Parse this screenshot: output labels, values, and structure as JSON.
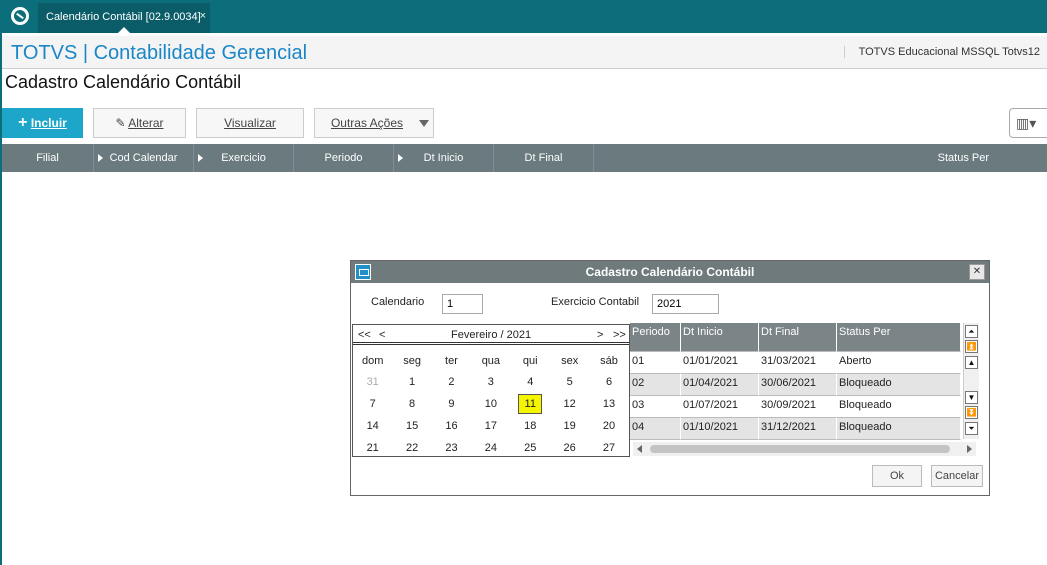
{
  "tab": {
    "title": "Calendário Contábil [02.9.0034]",
    "close": "×"
  },
  "header": {
    "app_title": "TOTVS | Contabilidade Gerencial",
    "env_info": "TOTVS Educacional MSSQL Totvs12"
  },
  "page": {
    "title": "Cadastro Calendário Contábil"
  },
  "toolbar": {
    "incluir": "Incluir",
    "alterar": "Alterar",
    "visualizar": "Visualizar",
    "outras_acoes": "Outras Ações"
  },
  "grid": {
    "columns": [
      "Filial",
      "Cod Calendar",
      "Exercicio",
      "Periodo",
      "Dt Inicio",
      "Dt Final",
      "Status Per"
    ]
  },
  "dialog": {
    "title": "Cadastro Calendário Contábil",
    "calendario_label": "Calendario",
    "calendario_value": "1",
    "exercicio_label": "Exercicio Contabil",
    "exercicio_value": "2021",
    "ok": "Ok",
    "cancel": "Cancelar"
  },
  "calendar": {
    "nav_prev_year": "<<",
    "nav_prev": "<",
    "month_label": "Fevereiro / 2021",
    "nav_next": ">",
    "nav_next_year": ">>",
    "weekdays": [
      "dom",
      "seg",
      "ter",
      "qua",
      "qui",
      "sex",
      "sáb"
    ],
    "weeks": [
      [
        "31",
        "1",
        "2",
        "3",
        "4",
        "5",
        "6"
      ],
      [
        "7",
        "8",
        "9",
        "10",
        "11",
        "12",
        "13"
      ],
      [
        "14",
        "15",
        "16",
        "17",
        "18",
        "19",
        "20"
      ],
      [
        "21",
        "22",
        "23",
        "24",
        "25",
        "26",
        "27"
      ]
    ],
    "selected_day": "11",
    "highlight_color": "#f5f500"
  },
  "periods": {
    "columns": [
      "Periodo",
      "Dt Inicio",
      "Dt Final",
      "Status Per"
    ],
    "rows": [
      [
        "01",
        "01/01/2021",
        "31/03/2021",
        "Aberto"
      ],
      [
        "02",
        "01/04/2021",
        "30/06/2021",
        "Bloqueado"
      ],
      [
        "03",
        "01/07/2021",
        "30/09/2021",
        "Bloqueado"
      ],
      [
        "04",
        "01/10/2021",
        "31/12/2021",
        "Bloqueado"
      ]
    ]
  },
  "colors": {
    "brand_teal": "#0c6e7a",
    "primary_button": "#1da6c9",
    "title_blue": "#1a86c8",
    "grid_header": "#6a7a7e"
  }
}
